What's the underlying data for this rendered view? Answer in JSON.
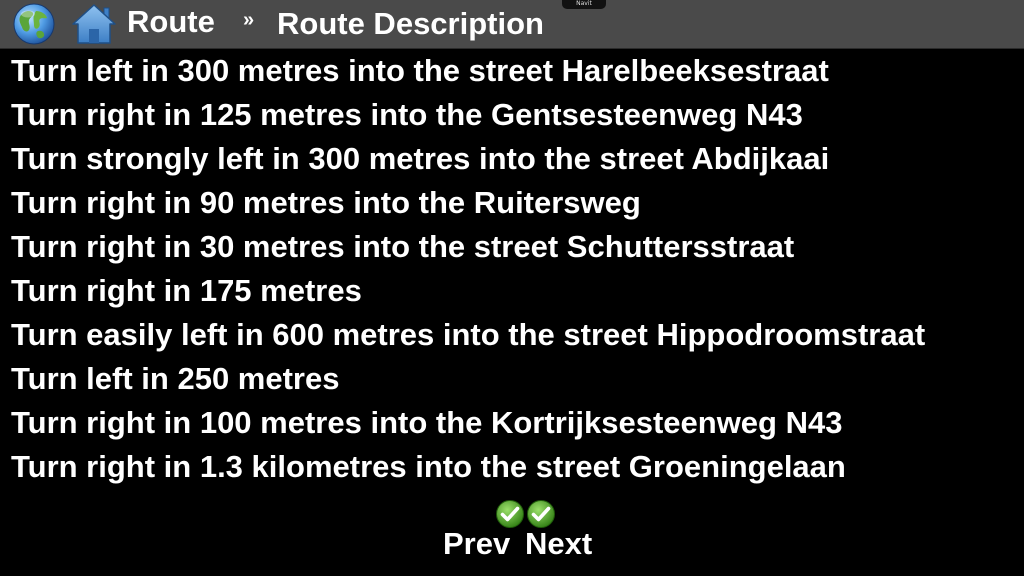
{
  "header": {
    "breadcrumb_root": "Route",
    "separator": "»",
    "title": "Route Description",
    "badge": "Navit",
    "icons": [
      "globe-icon",
      "home-icon"
    ]
  },
  "route": {
    "instructions": [
      "Turn left in 300 metres into the street Harelbeeksestraat",
      "Turn right in 125 metres into the Gentsesteenweg N43",
      "Turn strongly left in 300 metres into the street Abdijkaai",
      "Turn right in 90 metres into the Ruitersweg",
      "Turn right in 30 metres into the street Schuttersstraat",
      "Turn right in 175 metres",
      "Turn easily left in 600 metres into the street Hippodroomstraat",
      "Turn left in 250 metres",
      "Turn right in 100 metres into the Kortrijksesteenweg N43",
      "Turn right in 1.3 kilometres into the street Groeningelaan"
    ]
  },
  "pager": {
    "prev_label": "Prev",
    "next_label": "Next",
    "icon": "checkmark-icon"
  },
  "colors": {
    "background": "#000000",
    "header_bar": "#4a4a4a",
    "text": "#ffffff",
    "check_green": "#3f9a1c"
  }
}
